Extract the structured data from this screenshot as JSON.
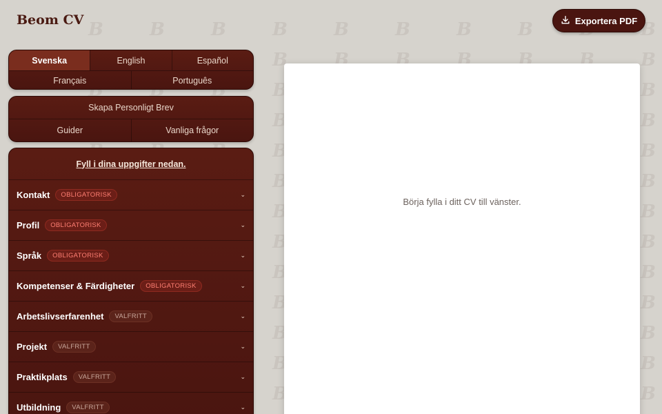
{
  "header": {
    "brand": "Beom CV",
    "export_label": "Exportera PDF",
    "export_icon": "download-icon"
  },
  "languages": {
    "row1": [
      "Svenska",
      "English",
      "Español"
    ],
    "row2": [
      "Français",
      "Português"
    ],
    "active": "Svenska"
  },
  "nav": {
    "cover_letter": "Skapa Personligt Brev",
    "guides": "Guider",
    "faq": "Vanliga frågor"
  },
  "form": {
    "intro": "Fyll i dina uppgifter nedan.",
    "sections": [
      {
        "title": "Kontakt",
        "badge": "OBLIGATORISK",
        "type": "required"
      },
      {
        "title": "Profil",
        "badge": "OBLIGATORISK",
        "type": "required"
      },
      {
        "title": "Språk",
        "badge": "OBLIGATORISK",
        "type": "required"
      },
      {
        "title": "Kompetenser & Färdigheter",
        "badge": "OBLIGATORISK",
        "type": "required"
      },
      {
        "title": "Arbetslivserfarenhet",
        "badge": "VALFRITT",
        "type": "optional"
      },
      {
        "title": "Projekt",
        "badge": "VALFRITT",
        "type": "optional"
      },
      {
        "title": "Praktikplats",
        "badge": "VALFRITT",
        "type": "optional"
      },
      {
        "title": "Utbildning",
        "badge": "VALFRITT",
        "type": "optional"
      }
    ]
  },
  "preview": {
    "hint": "Börja fylla i ditt CV till vänster."
  },
  "colors": {
    "accent": "#4a1510",
    "panel": "#5a1c13",
    "required_badge": "#ff7f73",
    "background": "#d6d3cd"
  }
}
